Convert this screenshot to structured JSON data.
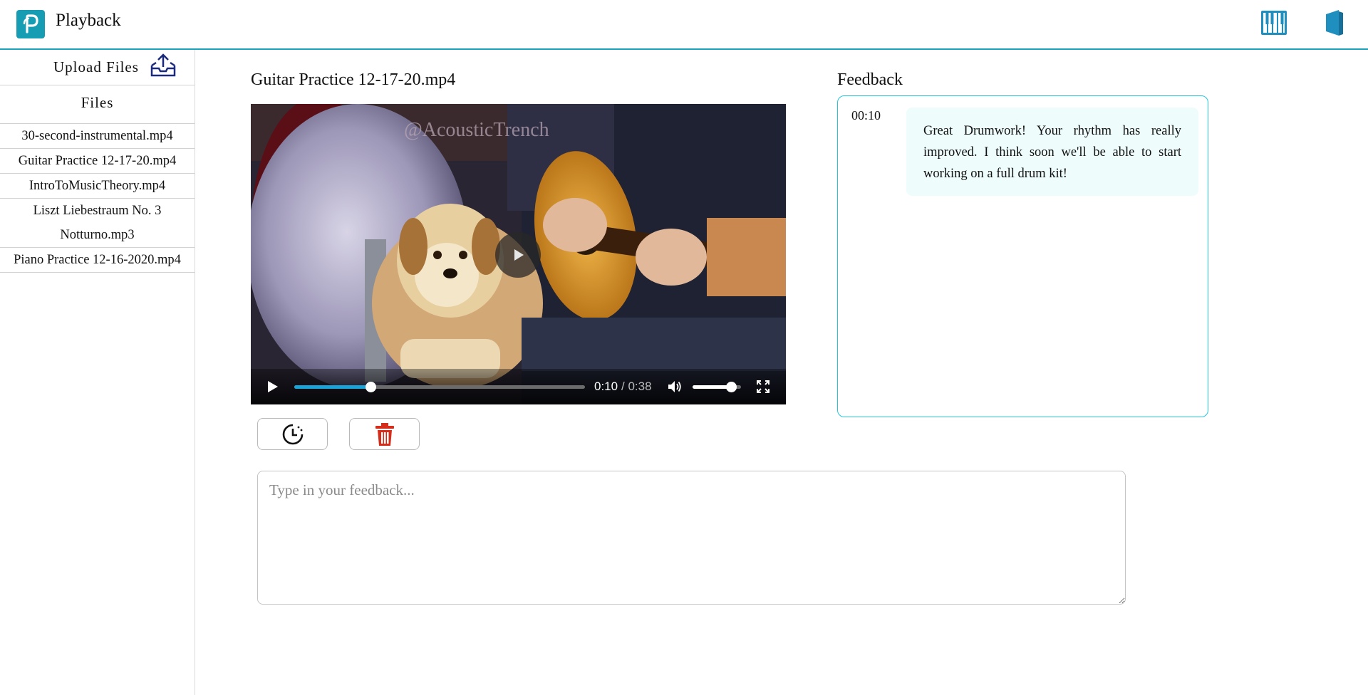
{
  "header": {
    "app_title": "Playback",
    "logo_letter": "P",
    "icons": [
      "piano-icon",
      "book-icon"
    ],
    "accent_color": "#1aa3bd"
  },
  "sidebar": {
    "upload_label": "Upload Files",
    "upload_icon": "upload-tray-icon",
    "files_heading": "Files",
    "files": [
      "30-second-instrumental.mp4",
      "Guitar Practice 12-17-20.mp4",
      "IntroToMusicTheory.mp4",
      "Liszt Liebestraum No. 3 Notturno.mp3",
      "Piano Practice 12-16-2020.mp4"
    ]
  },
  "video": {
    "title": "Guitar Practice 12-17-20.mp4",
    "watermark": "@AcousticTrench",
    "current_time": "0:10",
    "duration_text": "/ 0:38",
    "progress_fraction": 0.263,
    "volume_fraction": 0.8
  },
  "actions": {
    "timestamp_icon": "clock-icon",
    "delete_icon": "trash-icon",
    "delete_color": "#d62c1a"
  },
  "feedback_input": {
    "placeholder": "Type in your feedback..."
  },
  "feedback": {
    "title": "Feedback",
    "entries": [
      {
        "time": "00:10",
        "text": "Great Drumwork! Your rhythm has really improved. I think soon we'll be able to start working on a full drum kit!"
      }
    ]
  }
}
